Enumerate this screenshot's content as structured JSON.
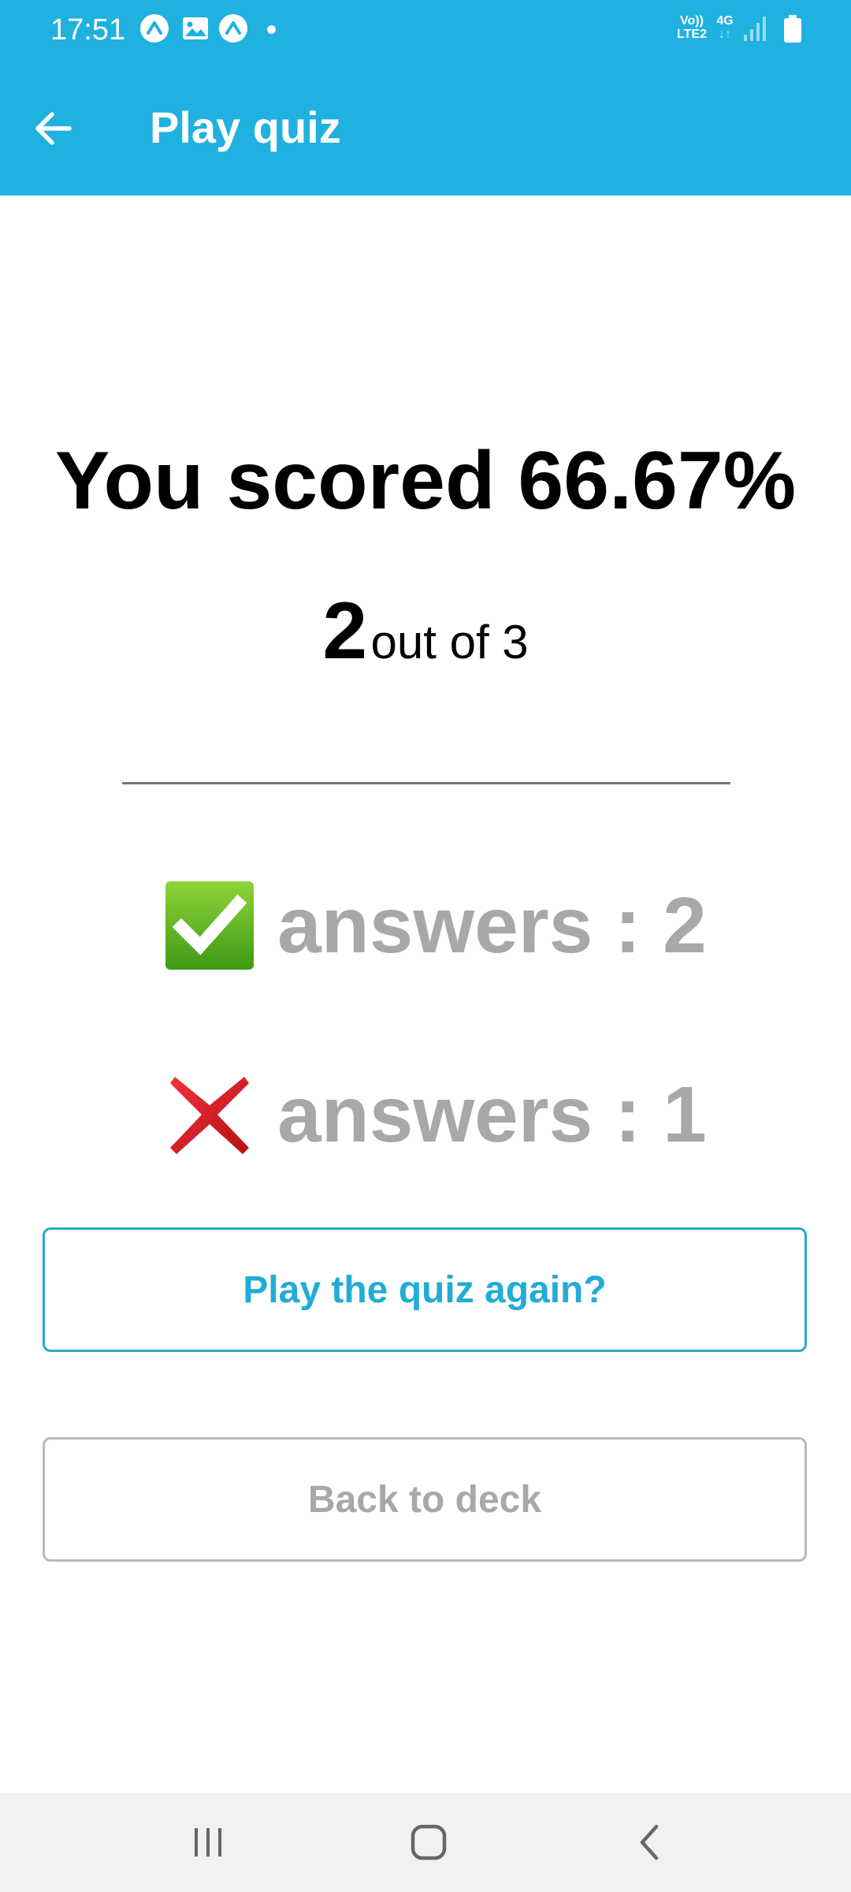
{
  "status_bar": {
    "time": "17:51",
    "icons": [
      "notification-a-icon",
      "image-icon",
      "notification-a-icon",
      "dot-icon"
    ],
    "volte_line1": "Vo))",
    "volte_line2": "LTE2",
    "network": "4G",
    "network_arrows": "↓↑",
    "signal": "signal-icon",
    "battery": "battery-icon"
  },
  "app_bar": {
    "back_icon": "arrow-left-icon",
    "title": "Play quiz"
  },
  "result": {
    "title": "You scored 66.67%",
    "correct_count": "2",
    "total_text": "out of 3"
  },
  "answers": {
    "correct_icon": "check-mark-icon",
    "correct_text": "answers : 2",
    "wrong_icon": "cross-mark-icon",
    "wrong_text": "answers : 1"
  },
  "buttons": {
    "play_again": "Play the quiz again?",
    "back_to_deck": "Back to deck"
  },
  "nav_bar": {
    "recents": "recents-icon",
    "home": "home-icon",
    "back": "back-icon"
  },
  "colors": {
    "primary": "#1fb1e0",
    "accent_text": "#22acd6",
    "muted_text": "#a8a8a8",
    "check_green": "#5fb51e",
    "cross_red": "#d8141c"
  }
}
